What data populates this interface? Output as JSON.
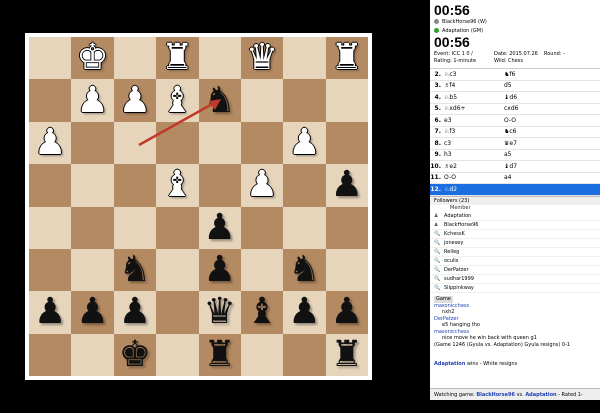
{
  "board": {
    "rows": [
      [
        "",
        "wK",
        "",
        "wR",
        "",
        "wQ",
        "",
        "wR"
      ],
      [
        "",
        "wP",
        "wP",
        "",
        "wB",
        "bN",
        "wP",
        ""
      ],
      [
        "wP",
        "",
        "",
        "",
        "",
        "",
        "wP",
        ""
      ],
      [
        "",
        "",
        "",
        "wP",
        "",
        "",
        "",
        ""
      ],
      [
        "",
        "",
        "",
        "",
        "wB",
        "",
        "wP",
        "",
        "bP"
      ],
      [
        "",
        "",
        "",
        "",
        "",
        "bP",
        "",
        ""
      ],
      [
        "",
        "",
        "bN",
        "",
        "bP",
        "",
        "bN",
        ""
      ],
      [
        "bP",
        "bP",
        "bP",
        "",
        "bQ",
        "bB",
        "bP",
        "bP"
      ]
    ],
    "rows_full": [
      [
        "",
        "wK",
        "",
        "wR",
        "",
        "wQ",
        "",
        "wR"
      ],
      [
        "",
        "wP",
        "wP",
        "wB",
        "bN",
        "",
        "",
        ""
      ],
      [
        "wP",
        "",
        "",
        "",
        "",
        "",
        "wP",
        ""
      ],
      [
        "",
        "",
        "",
        "",
        "",
        "",
        "",
        ""
      ],
      [
        "",
        "",
        "",
        "wB",
        "",
        "wP",
        "",
        "bP"
      ],
      [
        "",
        "",
        "",
        "",
        "bP",
        "",
        "",
        ""
      ],
      [
        "",
        "",
        "bN",
        "",
        "bP",
        "",
        "bN",
        ""
      ],
      [
        "bP",
        "bP",
        "bP",
        "",
        "bQ",
        "bB",
        "bP",
        "bP"
      ],
      [
        "",
        "",
        "bK",
        "",
        "bR",
        "",
        "",
        "bR"
      ]
    ],
    "light_color": "#e6d4bb",
    "dark_color": "#b48a62",
    "arrow_color": "#c0392b"
  },
  "clocks": {
    "top": "00:56",
    "bottom": "00:56"
  },
  "players": {
    "white": "BlackHorse96 (W)",
    "black": "Adaptation (GM)"
  },
  "info": {
    "event": "Event: ICC 1 0 /",
    "date": "Date: 2015.07.26",
    "round": "Round: -",
    "rating": "Rating: 1-minute",
    "wild": "Wild: Chess"
  },
  "moves": [
    {
      "n": "2.",
      "w": "♘c3",
      "b": "♞f6"
    },
    {
      "n": "3.",
      "w": "♗f4",
      "b": "d5"
    },
    {
      "n": "4.",
      "w": "♘b5",
      "b": "♝d6"
    },
    {
      "n": "5.",
      "w": "♘xd6+",
      "b": "cxd6"
    },
    {
      "n": "6.",
      "w": "e3",
      "b": "O-O"
    },
    {
      "n": "7.",
      "w": "♘f3",
      "b": "♞c6"
    },
    {
      "n": "8.",
      "w": "c3",
      "b": "♛e7"
    },
    {
      "n": "9.",
      "w": "h3",
      "b": "a5"
    },
    {
      "n": "10.",
      "w": "♗e2",
      "b": "♝d7"
    },
    {
      "n": "11.",
      "w": "O-O",
      "b": "a4"
    },
    {
      "n": "12.",
      "w": "♘d2",
      "b": ""
    }
  ],
  "followers": {
    "header": "Followers (23)",
    "col": "Member",
    "list": [
      {
        "icon": "♟",
        "name": "Adaptation"
      },
      {
        "icon": "♟",
        "name": "BlackHorse96"
      },
      {
        "icon": "🔍",
        "name": "KchessK"
      },
      {
        "icon": "🔍",
        "name": "jonesey"
      },
      {
        "icon": "🔍",
        "name": "Relleg"
      },
      {
        "icon": "🔍",
        "name": "oculis"
      },
      {
        "icon": "🔍",
        "name": "DerPatzer"
      },
      {
        "icon": "🔍",
        "name": "sudhar1999"
      },
      {
        "icon": "🔍",
        "name": "Slippinkway"
      }
    ]
  },
  "chat": {
    "tab": "Game",
    "lines": [
      {
        "user": "masonicchess",
        "text": "nxh2"
      },
      {
        "user": "DerPatzer",
        "text": "e5 hanging tho"
      },
      {
        "user": "masonicchess",
        "text": "nice move he win back with queen g1"
      }
    ],
    "result": "(Game 1246 (Gyula vs. Adaptation) Gyula resigns) 0-1"
  },
  "status": {
    "winner": "Adaptation",
    "text": " wins - White resigns"
  },
  "watching": {
    "prefix": "Watching game: ",
    "p1": "BlackHorse96",
    "vs": " vs. ",
    "p2": "Adaptation",
    "suffix": " - Rated 1-minute"
  }
}
